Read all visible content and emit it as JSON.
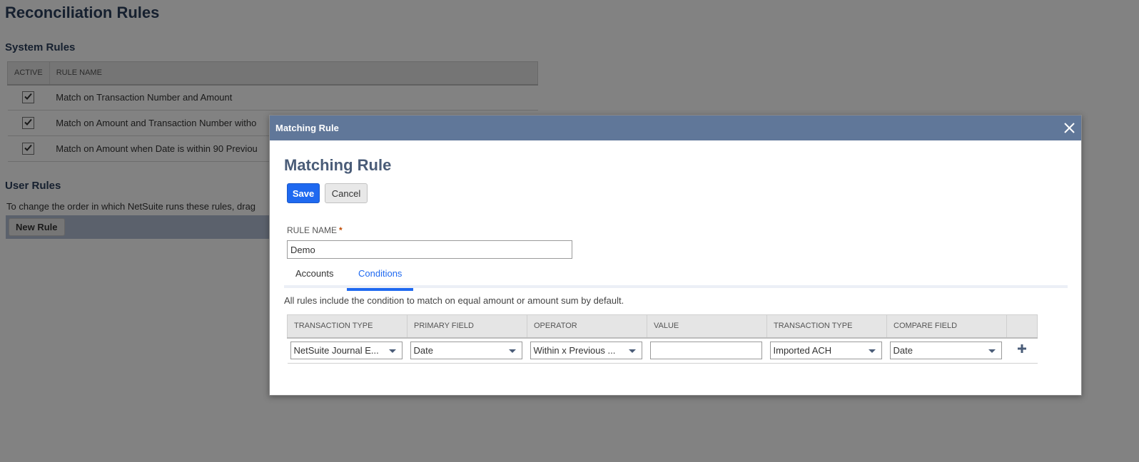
{
  "page": {
    "title": "Reconciliation Rules",
    "system_rules_title": "System Rules",
    "system_table": {
      "headers": [
        "ACTIVE",
        "RULE NAME"
      ],
      "rows": [
        {
          "active": true,
          "name": "Match on Transaction Number and Amount"
        },
        {
          "active": true,
          "name": "Match on Amount and Transaction Number witho"
        },
        {
          "active": true,
          "name": "Match on Amount when Date is within 90 Previou"
        }
      ]
    },
    "user_rules_title": "User Rules",
    "user_rules_note": "To change the order in which NetSuite runs these rules, drag",
    "new_rule_label": "New Rule"
  },
  "modal": {
    "header_title": "Matching Rule",
    "close_icon": "close-icon",
    "title": "Matching Rule",
    "save_label": "Save",
    "cancel_label": "Cancel",
    "rule_name_label": "RULE NAME",
    "required_mark": "*",
    "rule_name_value": "Demo",
    "tabs": [
      {
        "label": "Accounts",
        "active": false
      },
      {
        "label": "Conditions",
        "active": true
      }
    ],
    "note": "All rules include the condition to match on equal amount or amount sum by default.",
    "conditions": {
      "headers": [
        "TRANSACTION TYPE",
        "PRIMARY FIELD",
        "OPERATOR",
        "VALUE",
        "TRANSACTION TYPE",
        "COMPARE FIELD",
        ""
      ],
      "row": {
        "transaction_type": "NetSuite Journal E...",
        "primary_field": "Date",
        "operator": "Within x Previous ...",
        "value": "",
        "compare_transaction_type": "Imported ACH",
        "compare_field": "Date"
      }
    }
  },
  "colors": {
    "modal_header": "#607799",
    "primary_button": "#1f69f0",
    "title_text": "#2b3f5c",
    "active_tab": "#1f69f0"
  }
}
